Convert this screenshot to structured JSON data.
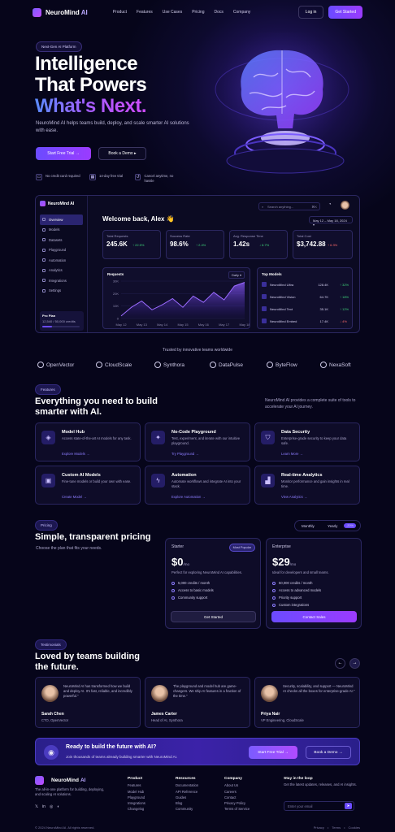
{
  "nav": {
    "brand": "NeuroMind",
    "brand_suffix": "AI",
    "links": [
      "Product",
      "Features",
      "Use Cases",
      "Pricing",
      "Docs",
      "Company"
    ],
    "login": "Log in",
    "cta": "Get Started"
  },
  "hero": {
    "badge": "Next-Gen AI Platform",
    "title_line1": "Intelligence",
    "title_line2": "That Powers",
    "title_line3": "What's Next.",
    "subtitle": "NeuroMind AI helps teams build, deploy, and scale smarter AI solutions with ease.",
    "primary": "Start Free Trial",
    "secondary": "Book a Demo",
    "perks": [
      {
        "icon": "credit-card-icon",
        "text": "No credit card required"
      },
      {
        "icon": "calendar-icon",
        "text": "14-day free trial"
      },
      {
        "icon": "cancel-icon",
        "text": "Cancel anytime, no hassle"
      }
    ]
  },
  "dashboard": {
    "brand": "NeuroMind AI",
    "menu": [
      "Overview",
      "Models",
      "Datasets",
      "Playground",
      "Automation",
      "Analytics",
      "Integrations",
      "Settings"
    ],
    "plan": {
      "name": "Pro Plan",
      "usage": "12,540 / 50,000 credits",
      "usage_fraction": 0.25
    },
    "search_placeholder": "Search anything...",
    "search_shortcut": "⌘K",
    "welcome": "Welcome back, Alex 👋",
    "date_range": "May 12 – May 18, 2024",
    "kpis": [
      {
        "label": "Total Requests",
        "value": "245.6K",
        "change": "↑ 22.5%",
        "neg": false
      },
      {
        "label": "Success Rate",
        "value": "98.6%",
        "change": "↑ 2.4%",
        "neg": false
      },
      {
        "label": "Avg. Response Time",
        "value": "1.42s",
        "change": "↓ 8.7%",
        "neg": false
      },
      {
        "label": "Total Cost",
        "value": "$3,742.88",
        "change": "↑ 6.3%",
        "neg": true
      }
    ],
    "requests_title": "Requests",
    "requests_range": "Daily",
    "top_models_title": "Top Models",
    "top_models": [
      {
        "name": "NeuroMind Ultra",
        "value": "128.4K",
        "change": "↑ 32%",
        "neg": false
      },
      {
        "name": "NeuroMind Vision",
        "value": "64.7K",
        "change": "↑ 18%",
        "neg": false
      },
      {
        "name": "NeuroMind Text",
        "value": "35.1K",
        "change": "↑ 12%",
        "neg": false
      },
      {
        "name": "NeuroMind Embed",
        "value": "17.4K",
        "change": "↓ 4%",
        "neg": true
      }
    ]
  },
  "chart_data": {
    "type": "area",
    "title": "Requests",
    "x": [
      "May 12",
      "May 13",
      "May 14",
      "May 15",
      "May 16",
      "May 17",
      "May 18"
    ],
    "y_ticks": [
      "0",
      "10K",
      "20K",
      "30K"
    ],
    "ylim": [
      0,
      30000
    ],
    "series": [
      {
        "name": "Requests",
        "values": [
          2000,
          9000,
          14000,
          7000,
          11000,
          16000,
          9000,
          18000,
          13000,
          21000,
          15000,
          26000,
          29000
        ]
      }
    ]
  },
  "trusted": {
    "heading": "Trusted by innovative teams worldwide",
    "logos": [
      "OpenVector",
      "CloudScale",
      "Synthora",
      "DataPulse",
      "ByteFlow",
      "NexaSoft"
    ]
  },
  "features": {
    "pill": "Features",
    "title_line1": "Everything you need to build",
    "title_line2": "smarter with AI.",
    "side_text": "NeuroMind AI provides a complete suite of tools to accelerate your AI journey.",
    "cards": [
      {
        "icon": "cube-icon",
        "title": "Model Hub",
        "desc": "Access state-of-the-art AI models for any task.",
        "link": "Explore Models →"
      },
      {
        "icon": "sparkle-icon",
        "title": "No-Code Playground",
        "desc": "Test, experiment, and iterate with our intuitive playground.",
        "link": "Try Playground →"
      },
      {
        "icon": "shield-icon",
        "title": "Data Security",
        "desc": "Enterprise-grade security to keep your data safe.",
        "link": "Learn More →"
      },
      {
        "icon": "chip-icon",
        "title": "Custom AI Models",
        "desc": "Fine-tune models or build your own with ease.",
        "link": "Create Model →"
      },
      {
        "icon": "bolt-icon",
        "title": "Automation",
        "desc": "Automate workflows and integrate AI into your stack.",
        "link": "Explore Automation →"
      },
      {
        "icon": "chart-icon",
        "title": "Real-time Analytics",
        "desc": "Monitor performance and gain insights in real time.",
        "link": "View Analytics →"
      }
    ]
  },
  "pricing": {
    "pill": "Pricing",
    "title": "Simple, transparent pricing",
    "subtitle": "Choose the plan that fits your needs.",
    "monthly": "Monthly",
    "yearly": "Yearly",
    "discount": "-20%",
    "plans": [
      {
        "name": "Starter",
        "badge": "Most Popular",
        "price": "$0",
        "per": "/mo",
        "desc": "Perfect for exploring NeuroMind AI capabilities.",
        "features": [
          "5,000 credits / month",
          "Access to basic models",
          "Community support"
        ],
        "cta": "Get Started"
      },
      {
        "name": "Enterprise",
        "price": "$29",
        "per": "/mo",
        "desc": "Ideal for developers and small teams.",
        "features": [
          "50,000 credits / month",
          "Access to advanced models",
          "Priority support",
          "Custom integrations"
        ],
        "cta": "Contact Sales"
      }
    ]
  },
  "testimonials": {
    "pill": "Testimonials",
    "title_line1": "Loved by teams building",
    "title_line2": "the future.",
    "items": [
      {
        "quote": "NeuroMind AI has transformed how we build and deploy AI. It's fast, reliable, and incredibly powerful.\"",
        "name": "Sarah Chen",
        "role": "CTO, OpenVector"
      },
      {
        "quote": "The playground and model hub are game-changers. We ship AI features in a fraction of the time.\"",
        "name": "James Carter",
        "role": "Head of AI, Synthora"
      },
      {
        "quote": "Security, scalability, and support — NeuroMind AI checks all the boxes for enterprise-grade AI.\"",
        "name": "Priya Nair",
        "role": "VP Engineering, CloudScale"
      }
    ]
  },
  "cta": {
    "title": "Ready to build the future with AI?",
    "subtitle": "Join thousands of teams already building smarter with NeuroMind AI.",
    "primary": "Start Free Trial",
    "secondary": "Book a Demo"
  },
  "footer": {
    "tagline": "The all-in-one platform for building, deploying, and scaling AI solutions.",
    "cols": [
      {
        "title": "Product",
        "items": [
          "Features",
          "Model Hub",
          "Playground",
          "Integrations",
          "Changelog"
        ]
      },
      {
        "title": "Resources",
        "items": [
          "Documentation",
          "API Reference",
          "Guides",
          "Blog",
          "Community"
        ]
      },
      {
        "title": "Company",
        "items": [
          "About Us",
          "Careers",
          "Contact",
          "Privacy Policy",
          "Terms of Service"
        ]
      }
    ],
    "newsletter_title": "Stay in the loop",
    "newsletter_text": "Get the latest updates, releases, and AI insights.",
    "email_placeholder": "Enter your email",
    "copyright": "© 2024 NeuroMind AI. All rights reserved.",
    "legal": [
      "Privacy",
      "Terms",
      "Cookies"
    ]
  },
  "colors": {
    "accent": "#7b5cff",
    "bg": "#06051a",
    "positive": "#3ed67a",
    "negative": "#ff6b6b"
  }
}
